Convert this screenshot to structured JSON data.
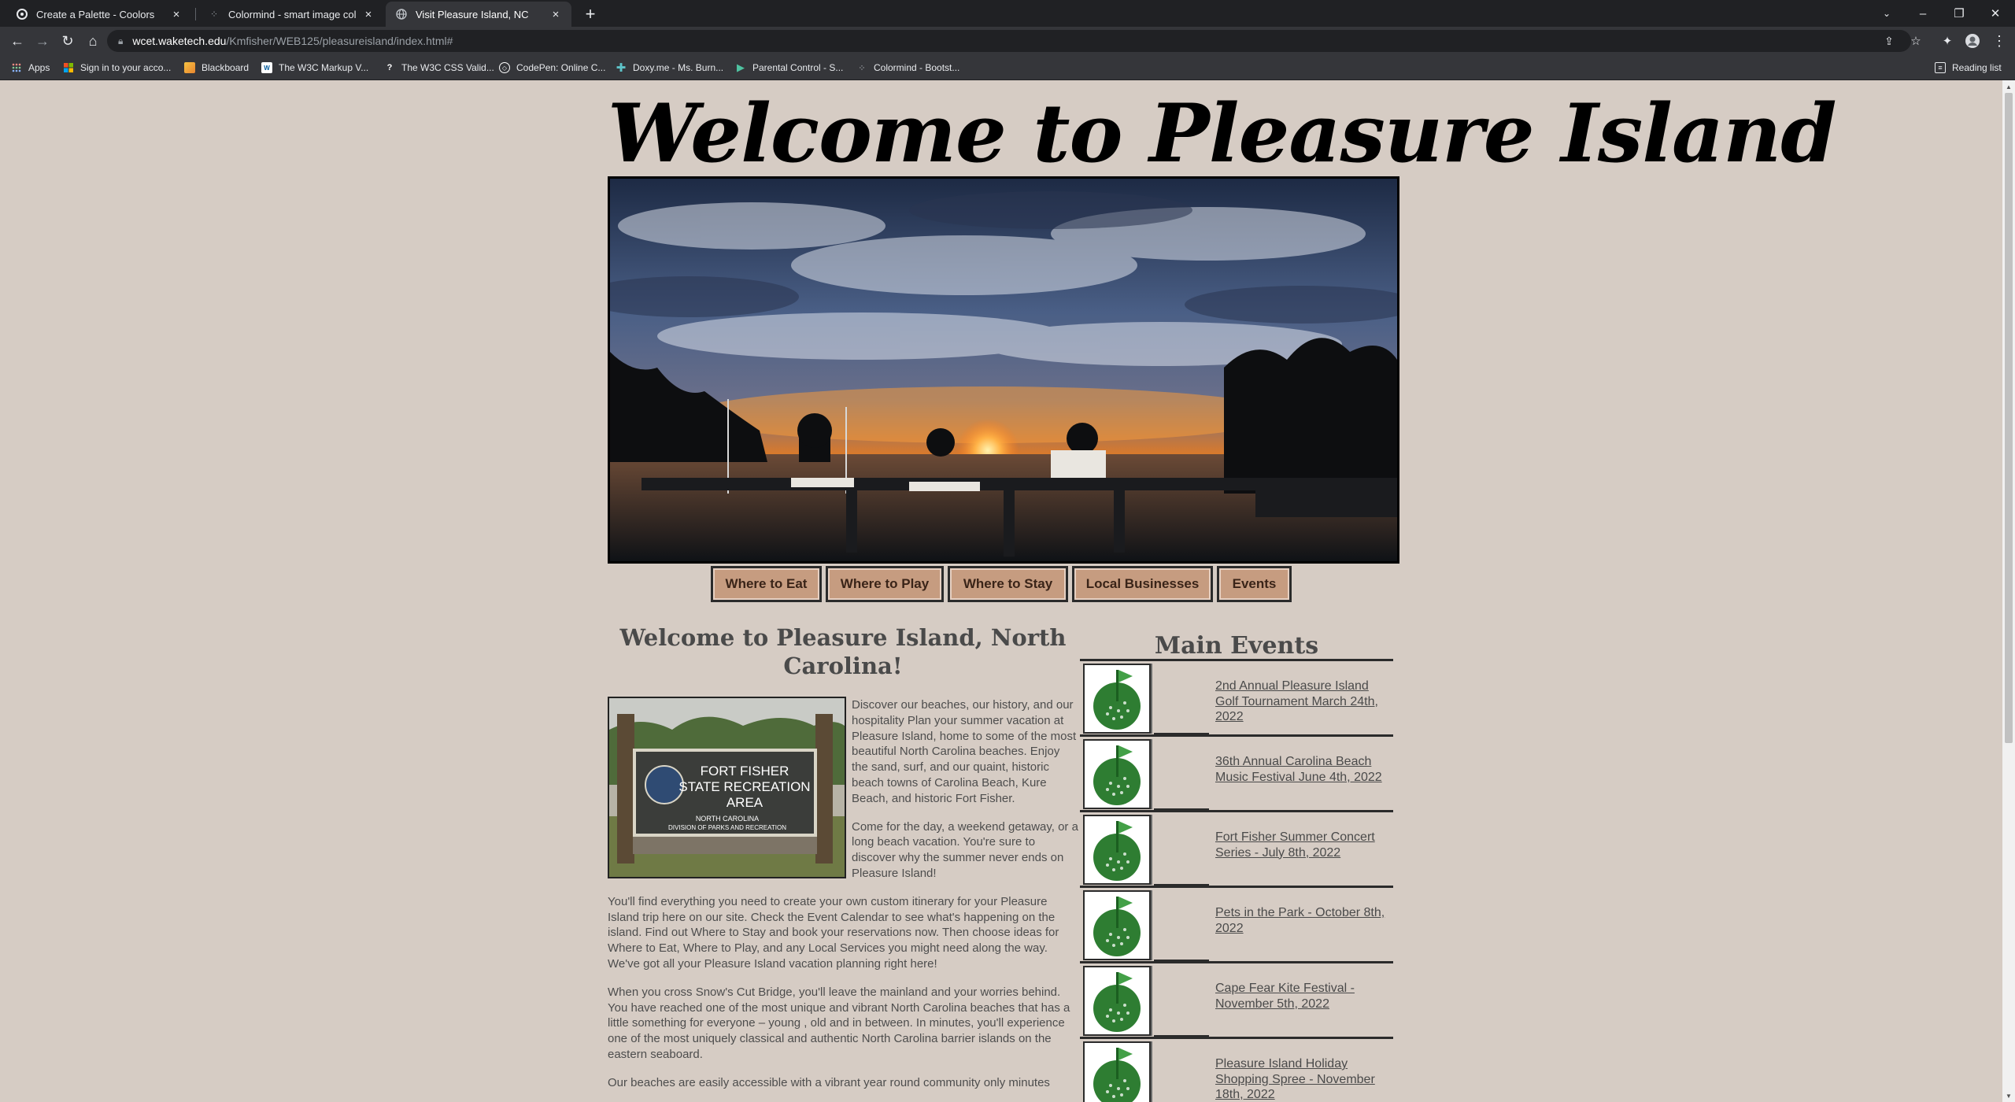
{
  "browser": {
    "tabs": [
      {
        "title": "Create a Palette - Coolors",
        "icon": "coolors-icon",
        "active": false
      },
      {
        "title": "Colormind - smart image color e",
        "icon": "colormind-icon",
        "active": false
      },
      {
        "title": "Visit Pleasure Island, NC",
        "icon": "globe-icon",
        "active": true
      }
    ],
    "new_tab_glyph": "+",
    "url_host": "wcet.waketech.edu",
    "url_path": "/Kmfisher/WEB125/pleasureisland/index.html#",
    "bookmarks": [
      {
        "label": "Apps",
        "icon": "apps-grid-icon"
      },
      {
        "label": "Sign in to your acco...",
        "icon": "microsoft-icon"
      },
      {
        "label": "Blackboard",
        "icon": "blackboard-icon"
      },
      {
        "label": "The W3C Markup V...",
        "icon": "w3c-icon"
      },
      {
        "label": "The W3C CSS Valid...",
        "icon": "w3c-css-icon"
      },
      {
        "label": "CodePen: Online C...",
        "icon": "codepen-icon"
      },
      {
        "label": "Doxy.me - Ms. Burn...",
        "icon": "doxy-icon"
      },
      {
        "label": "Parental Control - S...",
        "icon": "play-icon"
      },
      {
        "label": "Colormind - Bootst...",
        "icon": "colormind-icon"
      }
    ],
    "reading_list": "Reading list"
  },
  "page": {
    "site_title": "Welcome to Pleasure Island",
    "nav": [
      "Where to Eat",
      "Where to Play",
      "Where to Stay",
      "Local Businesses",
      "Events"
    ],
    "heading": "Welcome to Pleasure Island, North Carolina!",
    "sign_text": {
      "line1": "FORT FISHER",
      "line2": "STATE RECREATION",
      "line3": "AREA",
      "line4": "NORTH CAROLINA",
      "line5": "DIVISION OF PARKS AND RECREATION"
    },
    "paragraphs": [
      "Discover our beaches, our history, and our hospitality Plan your summer vacation at Pleasure Island, home to some of the most beautiful North Carolina beaches. Enjoy the sand, surf, and our quaint, historic beach towns of Carolina Beach, Kure Beach, and historic Fort Fisher.",
      "Come for the day, a weekend getaway, or a long beach vacation. You're sure to discover why the summer never ends on Pleasure Island!",
      "You'll find everything you need to create your own custom itinerary for your Pleasure Island trip here on our site. Check the Event Calendar to see what's happening on the island. Find out Where to Stay and book your reservations now. Then choose ideas for Where to Eat, Where to Play, and any Local Services you might need along the way. We've got all your Pleasure Island vacation planning right here!",
      "When you cross Snow's Cut Bridge, you'll leave the mainland and your worries behind. You have reached one of the most unique and vibrant North Carolina beaches that has a little something for everyone – young , old and in between. In minutes, you'll experience one of the most uniquely classical and authentic North Carolina barrier islands on the eastern seaboard.",
      "Our beaches are easily accessible with a vibrant year round community only minutes"
    ],
    "events_title": "Main Events",
    "events": [
      "2nd Annual Pleasure Island Golf Tournament March 24th, 2022",
      "36th Annual Carolina Beach Music Festival June 4th, 2022",
      "Fort Fisher Summer Concert Series - July 8th, 2022",
      "Pets in the Park - October 8th, 2022",
      "Cape Fear Kite Festival - November 5th, 2022",
      "Pleasure Island Holiday Shopping Spree - November 18th, 2022"
    ]
  },
  "colors": {
    "page_bg": "#d6ccc4",
    "nav_button": "#c69c80",
    "heading_text": "#4a4a4a",
    "golf_green": "#2e7d32"
  }
}
